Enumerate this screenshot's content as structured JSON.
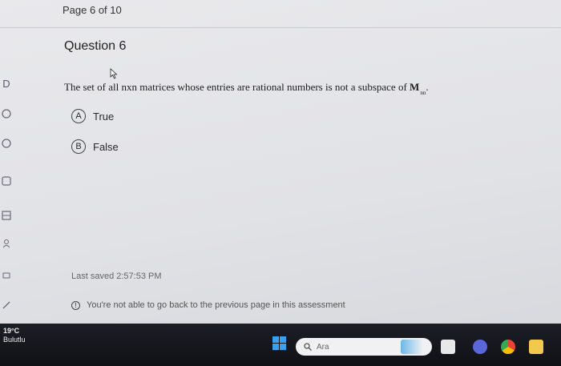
{
  "header": {
    "page_indicator": "Page 6 of 10"
  },
  "question": {
    "title": "Question 6",
    "text_prefix": "The set of all nxn matrices whose entries are rational numbers is not a subspace of ",
    "text_math": "M",
    "text_sub": "nn",
    "text_suffix": "."
  },
  "options": [
    {
      "letter": "A",
      "label": "True"
    },
    {
      "letter": "B",
      "label": "False"
    }
  ],
  "footer": {
    "saved": "Last saved 2:57:53 PM",
    "notice": "You're not able to go back to the previous page in this assessment"
  },
  "left_rail": [
    "D"
  ],
  "taskbar": {
    "temperature": "19°C",
    "condition": "Bulutlu",
    "search_placeholder": "Ara"
  }
}
